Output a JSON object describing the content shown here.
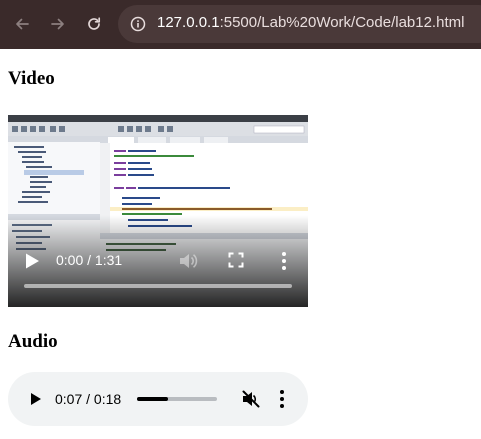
{
  "browser": {
    "url_host": "127.0.0.1",
    "url_rest": ":5500/Lab%20Work/Code/lab12.html",
    "toolbar_color": "#3a2a2a"
  },
  "page": {
    "video_heading": "Video",
    "audio_heading": "Audio"
  },
  "video": {
    "time": "0:00 / 1:31",
    "progress": 0,
    "icons": [
      "play-icon",
      "mute-icon",
      "fullscreen-icon",
      "more-options-icon"
    ],
    "thumbnail": "java-ide-code-editor-screenshot"
  },
  "audio": {
    "time": "0:07 / 0:18",
    "progress": 0.39,
    "muted": true,
    "icons": [
      "play-icon",
      "muted-icon",
      "more-options-icon"
    ]
  }
}
